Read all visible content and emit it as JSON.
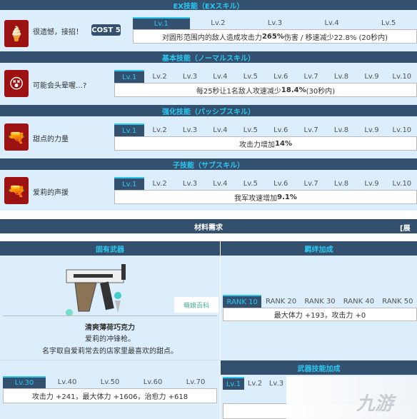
{
  "colors": {
    "header_bg": "#33506f",
    "header_text": "#2cc8f0",
    "panel_bg": "#dcedfc",
    "icon_bg": "#9c1212"
  },
  "ex": {
    "header": "EX技能（EXスキル）",
    "icon": "ice-cream-icon",
    "name": "很遗憾，接招！",
    "cost": "COST 5",
    "tabs": [
      "Lv.1",
      "Lv.2",
      "Lv.3",
      "Lv.4",
      "Lv.5"
    ],
    "desc_pre": "对圆形范围内的敌人造成攻击力 ",
    "desc_bold": "265%",
    "desc_post": "伤害 / 移速减少22.8% (20秒内)"
  },
  "normal": {
    "header": "基本技能（ノーマルスキル）",
    "icon": "dizzy-icon",
    "name": "可能会头晕喔…?",
    "tabs": [
      "Lv.1",
      "Lv.2",
      "Lv.3",
      "Lv.4",
      "Lv.5",
      "Lv.6",
      "Lv.7",
      "Lv.8",
      "Lv.9",
      "Lv.10"
    ],
    "desc_pre": "每25秒让1名敌人攻速减少 ",
    "desc_bold": "18.4%",
    "desc_post": " (30秒内)"
  },
  "passive": {
    "header": "强化技能（パッシブスキル）",
    "icon": "pistol-icon",
    "name": "甜点的力量",
    "tabs": [
      "Lv.1",
      "Lv.2",
      "Lv.3",
      "Lv.4",
      "Lv.5",
      "Lv.6",
      "Lv.7",
      "Lv.8",
      "Lv.9",
      "Lv.10"
    ],
    "desc_pre": "攻击力增加 ",
    "desc_bold": "14%",
    "desc_post": ""
  },
  "sub": {
    "header": "子技能（サブスキル）",
    "icon": "pistol-icon",
    "name": "爱莉的声援",
    "tabs": [
      "Lv.1",
      "Lv.2",
      "Lv.3",
      "Lv.4",
      "Lv.5",
      "Lv.6",
      "Lv.7",
      "Lv.8",
      "Lv.9",
      "Lv.10"
    ],
    "desc_pre": "我军攻速增加 ",
    "desc_bold": "9.1%",
    "desc_post": ""
  },
  "materials": {
    "header": "材料需求",
    "expand": "[展开"
  },
  "weapon": {
    "header": "固有武器",
    "watermark": "萌娘百科",
    "name": "清爽薄荷巧克力",
    "line1": "爱莉的冲锋枪。",
    "line2": "名字取自爱莉常去的店家里最喜欢的甜点。",
    "tabs": [
      "Lv.30",
      "Lv.40",
      "Lv.50",
      "Lv.60",
      "Lv.70"
    ],
    "desc": "攻击力 +241，最大体力 +1606，治愈力 +618"
  },
  "bond": {
    "header": "羁绊加成",
    "tabs": [
      "RANK 10",
      "RANK 20",
      "RANK 30",
      "RANK 40",
      "RANK 50"
    ],
    "desc": "最大体力 +193，攻击力 +0"
  },
  "weapon_skill": {
    "header": "武器技能加成",
    "tabs": [
      "Lv.1",
      "Lv.2",
      "Lv.3"
    ]
  },
  "site_logo": "九游"
}
